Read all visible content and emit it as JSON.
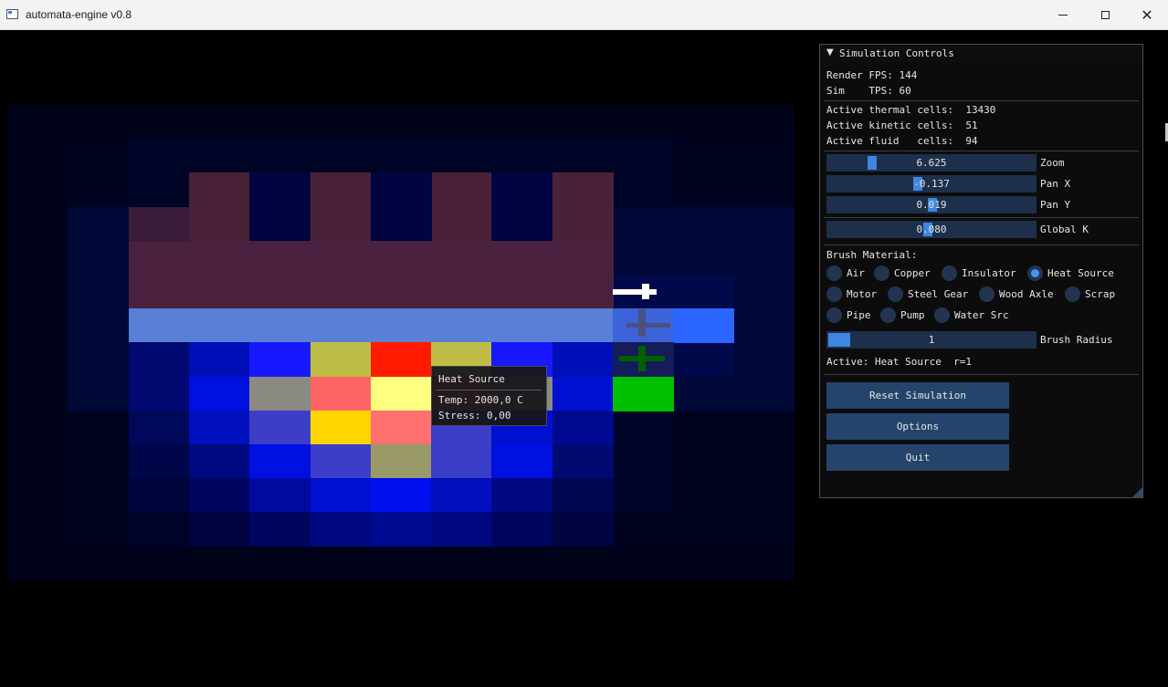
{
  "window": {
    "title": "automata-engine v0.8"
  },
  "panel": {
    "title": "Simulation Controls",
    "render_fps_label": "Render FPS: 144",
    "sim_tps_label": "Sim    TPS: 60",
    "thermal_label": "Active thermal cells:  13430",
    "kinetic_label": "Active kinetic cells:  51",
    "fluid_label": "Active fluid   cells:  94",
    "sliders": [
      {
        "value": "6.625",
        "label": "Zoom",
        "fraction": 0.2
      },
      {
        "value": "-0.137",
        "label": "Pan X",
        "fraction": 0.43
      },
      {
        "value": "0.019",
        "label": "Pan Y",
        "fraction": 0.505
      },
      {
        "value": "0.080",
        "label": "Global K",
        "fraction": 0.48
      }
    ],
    "brush_material_label": "Brush Material:",
    "materials": [
      {
        "label": "Air",
        "selected": false
      },
      {
        "label": "Copper",
        "selected": false
      },
      {
        "label": "Insulator",
        "selected": false
      },
      {
        "label": "Heat Source",
        "selected": true
      },
      {
        "label": "Motor",
        "selected": false
      },
      {
        "label": "Steel Gear",
        "selected": false
      },
      {
        "label": "Wood Axle",
        "selected": false
      },
      {
        "label": "Scrap",
        "selected": false
      },
      {
        "label": "Pipe",
        "selected": false
      },
      {
        "label": "Pump",
        "selected": false
      },
      {
        "label": "Water Src",
        "selected": false
      }
    ],
    "brush_radius": {
      "value": "1",
      "label": "Brush Radius",
      "fraction": 0.0
    },
    "active_label": "Active: Heat Source  r=1",
    "buttons": {
      "reset": "Reset Simulation",
      "options": "Options",
      "quit": "Quit"
    }
  },
  "tooltip": {
    "title": "Heat Source",
    "temp": "Temp:   2000,0 C",
    "stress": "Stress: 0,00"
  },
  "colors": {
    "accent": "#4296fa",
    "frame_bg": "#1d2f4a",
    "button_bg": "#25446b",
    "hot": "#ff1a00",
    "heat_source_yellow": "#ffd500",
    "pipe_blue": "#5a7fd6",
    "motor_green": "#00c000"
  }
}
